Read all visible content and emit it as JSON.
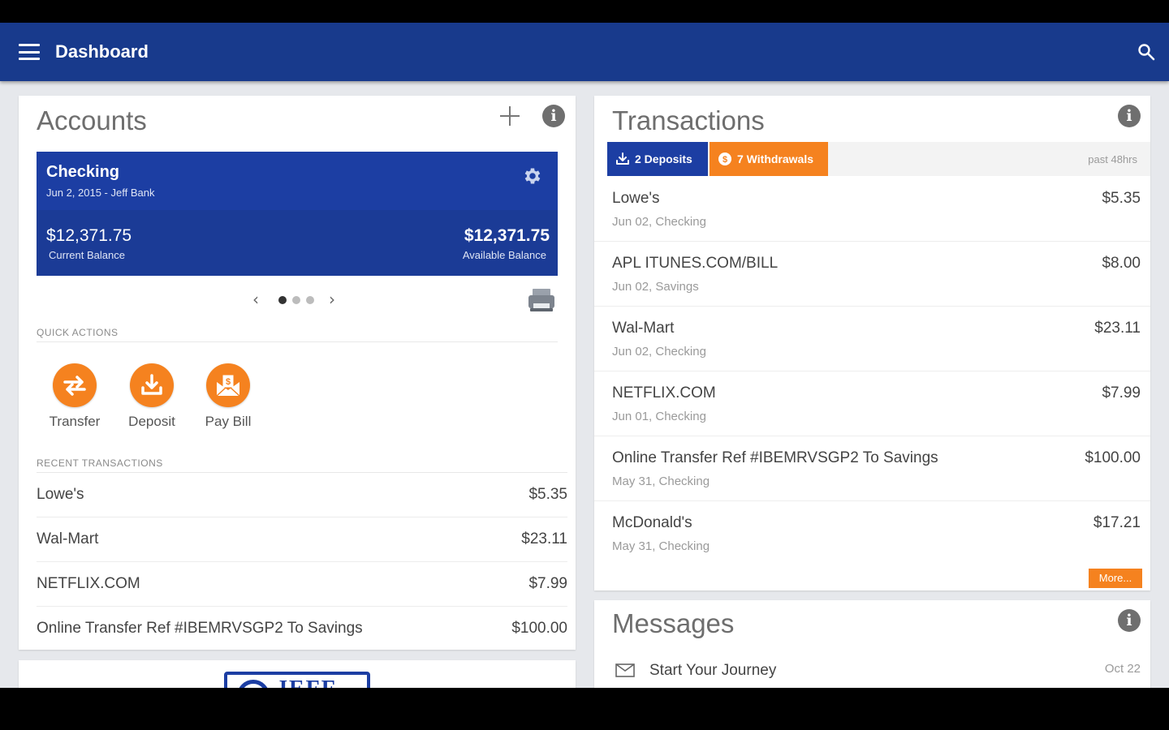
{
  "app": {
    "title": "Dashboard"
  },
  "accounts": {
    "title": "Accounts",
    "account": {
      "name": "Checking",
      "subtitle": "Jun 2, 2015 - Jeff Bank",
      "current_balance": "$12,371.75",
      "current_balance_label": "Current Balance",
      "available_balance": "$12,371.75",
      "available_balance_label": "Available Balance"
    },
    "pager": {
      "count": 3,
      "active": 1
    },
    "quick_actions_label": "QUICK ACTIONS",
    "quick_actions": [
      {
        "label": "Transfer",
        "icon": "transfer-icon"
      },
      {
        "label": "Deposit",
        "icon": "deposit-icon"
      },
      {
        "label": "Pay Bill",
        "icon": "pay-bill-icon"
      }
    ],
    "recent_label": "RECENT TRANSACTIONS",
    "recent": [
      {
        "name": "Lowe's",
        "amount": "$5.35"
      },
      {
        "name": "Wal-Mart",
        "amount": "$23.11"
      },
      {
        "name": "NETFLIX.COM",
        "amount": "$7.99"
      },
      {
        "name": "Online Transfer Ref #IBEMRVSGP2 To Savings",
        "amount": "$100.00"
      }
    ]
  },
  "transactions": {
    "title": "Transactions",
    "deposits_chip": "2 Deposits",
    "withdrawals_chip": "7 Withdrawals",
    "window": "past 48hrs",
    "items": [
      {
        "name": "Lowe's",
        "meta": "Jun 02, Checking",
        "amount": "$5.35"
      },
      {
        "name": "APL ITUNES.COM/BILL",
        "meta": "Jun 02, Savings",
        "amount": "$8.00"
      },
      {
        "name": "Wal-Mart",
        "meta": "Jun 02, Checking",
        "amount": "$23.11"
      },
      {
        "name": "NETFLIX.COM",
        "meta": "Jun 01, Checking",
        "amount": "$7.99"
      },
      {
        "name": "Online Transfer Ref #IBEMRVSGP2 To Savings",
        "meta": "May 31, Checking",
        "amount": "$100.00"
      },
      {
        "name": "McDonald's",
        "meta": "May 31, Checking",
        "amount": "$17.21"
      }
    ],
    "more_label": "More..."
  },
  "messages": {
    "title": "Messages",
    "items": [
      {
        "subject": "Start Your Journey",
        "date": "Oct 22"
      }
    ]
  },
  "logo": {
    "text": "JEFF"
  },
  "colors": {
    "primary": "#1c3ea3",
    "appbar": "#183a8c",
    "accent": "#f5821f",
    "background": "#e6e8ec"
  }
}
